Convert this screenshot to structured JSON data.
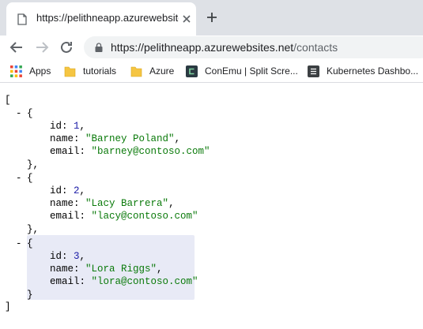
{
  "browser": {
    "tab": {
      "title": "https://pelithneapp.azurewebsites"
    },
    "url": {
      "host": "https://pelithneapp.azurewebsites.net",
      "path": "/contacts"
    },
    "bookmarks": [
      {
        "label": "Apps",
        "icon": "apps-grid-icon"
      },
      {
        "label": "tutorials",
        "icon": "folder-icon"
      },
      {
        "label": "Azure",
        "icon": "folder-icon"
      },
      {
        "label": "ConEmu | Split Scre...",
        "icon": "conemu-icon"
      },
      {
        "label": "Kubernetes Dashbo...",
        "icon": "kubernetes-icon"
      }
    ]
  },
  "json": {
    "open_bracket": "[",
    "close_bracket": "]",
    "items": [
      {
        "id": "1",
        "name": "\"Barney Poland\"",
        "email": "\"barney@contoso.com\""
      },
      {
        "id": "2",
        "name": "\"Lacy Barrera\"",
        "email": "\"lacy@contoso.com\""
      },
      {
        "id": "3",
        "name": "\"Lora Riggs\"",
        "email": "\"lora@contoso.com\""
      }
    ],
    "labels": {
      "id": "id",
      "name": "name",
      "email": "email"
    }
  },
  "colors": {
    "tabstrip": "#dee1e6",
    "omnibox": "#f1f3f4",
    "string": "#0a7a0a",
    "number": "#1a1aa6",
    "highlight": "#e8eaf6"
  }
}
